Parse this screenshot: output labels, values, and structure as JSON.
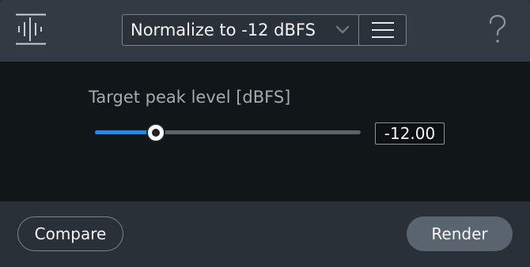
{
  "header": {
    "logo_icon": "waveform-logo-icon",
    "preset": {
      "selected": "Normalize to -12 dBFS",
      "dropdown_icon": "chevron-down-icon"
    },
    "menu_icon": "hamburger-menu-icon",
    "help_icon": "question-mark-icon"
  },
  "panel": {
    "parameter": {
      "label": "Target peak level [dBFS]",
      "value": "-12.00",
      "slider_fraction": 0.23
    }
  },
  "footer": {
    "compare_label": "Compare",
    "render_label": "Render"
  },
  "colors": {
    "accent": "#1a8df2",
    "panel_bg": "#111619",
    "header_bg": "#333a43",
    "footer_bg": "#2a3038",
    "render_button": "#5a646f"
  }
}
